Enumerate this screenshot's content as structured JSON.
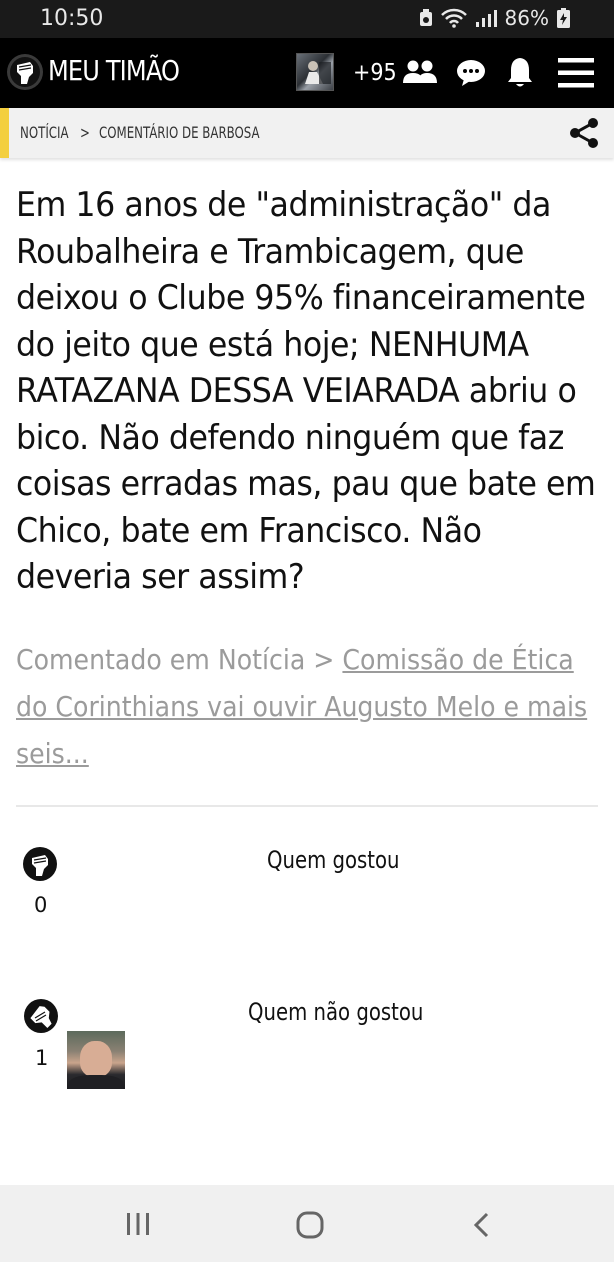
{
  "status_bar": {
    "time": "10:50",
    "battery": "86%"
  },
  "header": {
    "title": "MEU TIMÃO",
    "points": "+95"
  },
  "breadcrumb": {
    "item1": "NOTÍCIA",
    "separator": ">",
    "item2": "COMENTÁRIO DE BARBOSA"
  },
  "comment": {
    "text": "Em 16 anos de \"administração\" da Roubalheira e Trambicagem, que deixou o Clube 95% financeiramente do jeito que está hoje; NENHUMA RATAZANA DESSA VEIARADA abriu o bico. Não defendo ninguém que faz coisas erradas mas, pau que bate em Chico, bate em Francisco. Não deveria ser assim?"
  },
  "context": {
    "prefix": "Comentado em Notícia > ",
    "link": "Comissão de Ética do Corinthians vai ouvir Augusto Melo e mais seis..."
  },
  "reactions": {
    "likes": {
      "title": "Quem gostou",
      "count": "0"
    },
    "dislikes": {
      "title": "Quem não gostou",
      "count": "1"
    }
  },
  "colors": {
    "accent": "#f3cf3f",
    "header_bg": "#000000",
    "muted_text": "#9b9b9b"
  }
}
